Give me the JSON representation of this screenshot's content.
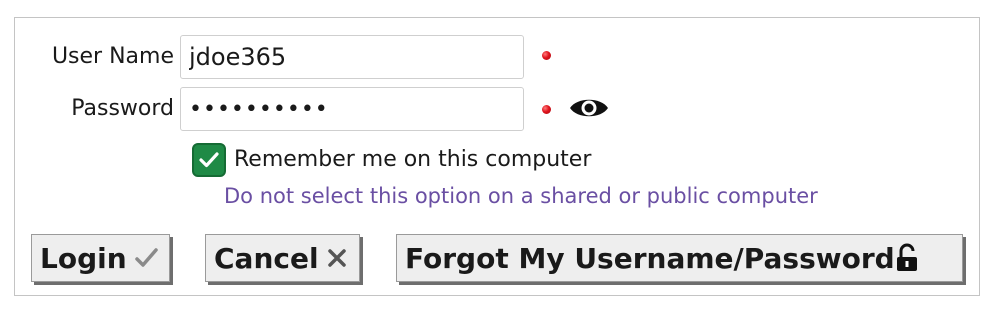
{
  "form": {
    "username_label": "User Name",
    "username_value": "jdoe365",
    "password_label": "Password",
    "password_value": "••••••••••",
    "remember_label": "Remember me on this computer",
    "remember_checked": true,
    "shared_hint": "Do not select this option on a shared or public computer"
  },
  "buttons": {
    "login_label": "Login",
    "cancel_label": "Cancel",
    "forgot_label": "Forgot My Username/Password"
  },
  "icons": {
    "required": "required-dot-icon",
    "show_password": "eye-icon",
    "check": "checkmark-icon",
    "login": "checkmark-icon",
    "cancel": "close-icon",
    "forgot": "unlock-icon"
  },
  "colors": {
    "checkbox_fill": "#1f8a46",
    "hint_text": "#6a4fa3",
    "required_dot": "#e0141e",
    "button_bg": "#eeeeee"
  }
}
